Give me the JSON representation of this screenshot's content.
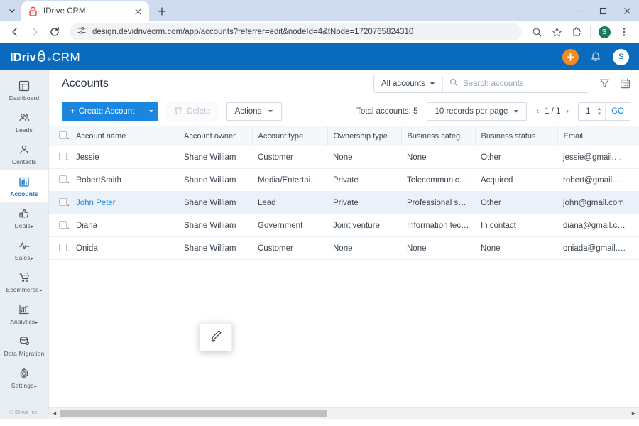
{
  "browser": {
    "tab": {
      "title": "IDrive CRM",
      "favicon_icon": "idrive-lock-icon",
      "close_icon": "close-icon"
    },
    "tabstrip_chevron_icon": "chevron-down-icon",
    "new_tab_label": "+",
    "window_controls": {
      "minimize": "–",
      "maximize": "□",
      "close": "×"
    },
    "nav": {
      "back_icon": "back-arrow-icon",
      "forward_icon": "forward-arrow-icon",
      "reload_icon": "reload-icon"
    },
    "omnibox": {
      "site_settings_icon": "site-settings-icon",
      "url": "design.devidrivecrm.com/app/accounts?referrer=edit&nodeId=4&tNode=1720765824310"
    },
    "actions": {
      "search_icon": "search-icon",
      "bookmark_icon": "star-icon",
      "extensions_icon": "extensions-puzzle-icon",
      "profile_initial": "S",
      "menu_icon": "three-dot-menu-icon"
    }
  },
  "app_header": {
    "logo_primary": "IDriv",
    "logo_registered": "®",
    "logo_suffix": "CRM",
    "add_button_label": "+",
    "notifications_icon": "bell-icon",
    "avatar_initial": "S",
    "brand_color": "#0a6bbd",
    "accent_color": "#f28b21"
  },
  "sidebar": {
    "items": [
      {
        "label": "Dashboard",
        "icon": "dashboard-icon",
        "active": false,
        "has_caret": false
      },
      {
        "label": "Leads",
        "icon": "leads-icon",
        "active": false,
        "has_caret": false
      },
      {
        "label": "Contacts",
        "icon": "contacts-icon",
        "active": false,
        "has_caret": false
      },
      {
        "label": "Accounts",
        "icon": "accounts-icon",
        "active": true,
        "has_caret": false
      },
      {
        "label": "Deals",
        "icon": "thumbs-up-icon",
        "active": false,
        "has_caret": true
      },
      {
        "label": "Sales",
        "icon": "pulse-icon",
        "active": false,
        "has_caret": true
      },
      {
        "label": "Ecommerce",
        "icon": "cart-icon",
        "active": false,
        "has_caret": true
      },
      {
        "label": "Analytics",
        "icon": "bar-chart-icon",
        "active": false,
        "has_caret": true
      },
      {
        "label": "Data Migration",
        "icon": "database-icon",
        "active": false,
        "has_caret": false
      },
      {
        "label": "Settings",
        "icon": "gear-icon",
        "active": false,
        "has_caret": true
      }
    ],
    "footer": "© IDrive Inc."
  },
  "page": {
    "title": "Accounts",
    "scope_filter": {
      "label": "All accounts",
      "caret_icon": "chevron-down-icon"
    },
    "search": {
      "placeholder": "Search accounts",
      "value": "",
      "icon": "search-icon"
    },
    "filter_icon": "filter-funnel-icon",
    "calendar_icon": "calendar-icon"
  },
  "toolbar": {
    "create_label": "Create Account",
    "create_plus": "+",
    "create_caret_icon": "chevron-down-icon",
    "delete_label": "Delete",
    "delete_icon": "trash-icon",
    "delete_disabled": true,
    "actions_label": "Actions",
    "actions_caret_icon": "chevron-down-icon",
    "total_label": "Total accounts:",
    "total_value": "5",
    "records_per_page": "10 records per page",
    "records_caret_icon": "chevron-down-icon",
    "prev_icon": "‹",
    "page_indicator": "1 / 1",
    "next_icon": "›",
    "page_input_value": "1",
    "spinner_up": "▲",
    "spinner_down": "▼",
    "go_label": "GO"
  },
  "table": {
    "columns": [
      "Account name",
      "Account owner",
      "Account type",
      "Ownership type",
      "Business category",
      "Business status",
      "Email"
    ],
    "column_picker_icon": "column-chooser-icon",
    "header_checkbox_icon": "checkbox-icon",
    "rows": [
      {
        "name": "Jessie",
        "owner": "Shane William",
        "type": "Customer",
        "ownership": "None",
        "category": "None",
        "status": "Other",
        "email": "jessie@gmail.com",
        "selected": false
      },
      {
        "name": "RobertSmith",
        "owner": "Shane William",
        "type": "Media/Entertainment",
        "ownership": "Private",
        "category": "Telecommunications",
        "status": "Acquired",
        "email": "robert@gmail.com",
        "selected": false
      },
      {
        "name": "John Peter",
        "owner": "Shane William",
        "type": "Lead",
        "ownership": "Private",
        "category": "Professional services",
        "status": "Other",
        "email": "john@gmail.com",
        "selected": true
      },
      {
        "name": "Diana",
        "owner": "Shane William",
        "type": "Government",
        "ownership": "Joint venture",
        "category": "Information technol...",
        "status": "In contact",
        "email": "diana@gmail.com",
        "selected": false
      },
      {
        "name": "Onida",
        "owner": "Shane William",
        "type": "Customer",
        "ownership": "None",
        "category": "None",
        "status": "None",
        "email": "oniada@gmail.com",
        "selected": false
      }
    ]
  },
  "row_popup": {
    "icon": "edit-pencil-icon"
  },
  "scrollbar": {
    "left_arrow": "◀",
    "right_arrow": "▶",
    "thumb_percent": "47"
  }
}
